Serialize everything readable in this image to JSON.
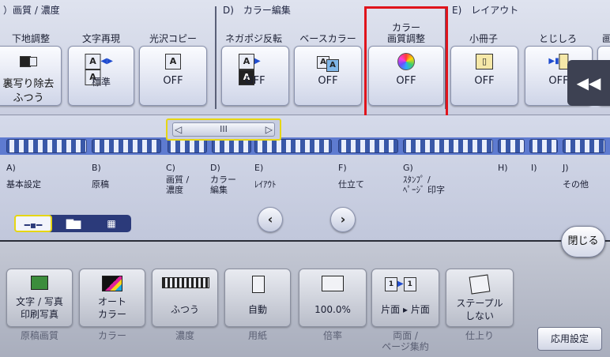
{
  "top_groups": [
    {
      "key": "quality",
      "header": "）画質 / 濃度"
    },
    {
      "key": "color",
      "header": "D)　カラー編集"
    },
    {
      "key": "layout",
      "header": "E)　レイアウト"
    }
  ],
  "top_buttons": [
    {
      "key": "bg",
      "title": "下地調整",
      "label_line1": "裏写り除去",
      "label_line2": "ふつう"
    },
    {
      "key": "text_repro",
      "title": "文字再現",
      "label": "標準"
    },
    {
      "key": "gloss",
      "title": "光沢コピー",
      "label": "OFF"
    },
    {
      "key": "negapos",
      "title": "ネガポジ反転",
      "label": "OFF"
    },
    {
      "key": "base_color",
      "title": "ベースカラー",
      "label": "OFF"
    },
    {
      "key": "color_adjust",
      "title_line1": "カラー",
      "title_line2": "画質調整",
      "label": "OFF"
    },
    {
      "key": "booklet",
      "title": "小冊子",
      "label": "OFF"
    },
    {
      "key": "binding",
      "title": "とじしろ",
      "label": "OFF"
    },
    {
      "key": "cut",
      "title": "画"
    }
  ],
  "collapse_icon": "◀◀",
  "scroll_glyphs": {
    "left": "◁",
    "thumb": "III",
    "right": "▷"
  },
  "nav_labels": [
    {
      "key": "A",
      "line1": "A)",
      "line2": "基本設定"
    },
    {
      "key": "B",
      "line1": "B)",
      "line2": "原稿"
    },
    {
      "key": "C",
      "line1": "C)",
      "line2": "画質 /",
      "line3": "濃度"
    },
    {
      "key": "D",
      "line1": "D)",
      "line2": "カラー",
      "line3": "編集"
    },
    {
      "key": "E",
      "line1": "E)",
      "line2": "ﾚｲｱｳﾄ"
    },
    {
      "key": "F",
      "line1": "F)",
      "line2": "仕立て"
    },
    {
      "key": "G",
      "line1": "G)",
      "line2": "ｽﾀﾝﾌﾟ /",
      "line3": "ﾍﾟｰｼﾞ 印字"
    },
    {
      "key": "H",
      "line1": "H)"
    },
    {
      "key": "I",
      "line1": "I)"
    },
    {
      "key": "J",
      "line1": "J)",
      "line2": "その他"
    }
  ],
  "view_toggle": {
    "seg1": "━▪━",
    "seg2": "▇▆",
    "seg3": "▦"
  },
  "pager": {
    "prev": "‹",
    "next": "›"
  },
  "close_label": "閉じる",
  "summary": [
    {
      "key": "original_quality",
      "line1": "文字 / 写真",
      "line2": "印刷写真",
      "caption": "原稿画質"
    },
    {
      "key": "color",
      "line1": "オート",
      "line2": "カラー",
      "caption": "カラー"
    },
    {
      "key": "density",
      "line1": "ふつう",
      "caption": "濃度"
    },
    {
      "key": "paper",
      "line1": "自動",
      "caption": "用紙"
    },
    {
      "key": "zoom",
      "line1": "100.0%",
      "caption": "倍率"
    },
    {
      "key": "duplex",
      "line1": "片面 ▸ 片面",
      "caption": "両面 /",
      "caption2": "ページ集約"
    },
    {
      "key": "finish",
      "line1": "ステープル",
      "line2": "しない",
      "caption": "仕上り"
    }
  ],
  "advanced_label": "応用設定",
  "colors": {
    "highlight": "#e0141c",
    "focus": "#e6d614",
    "nav_blue": "#3958a8"
  }
}
